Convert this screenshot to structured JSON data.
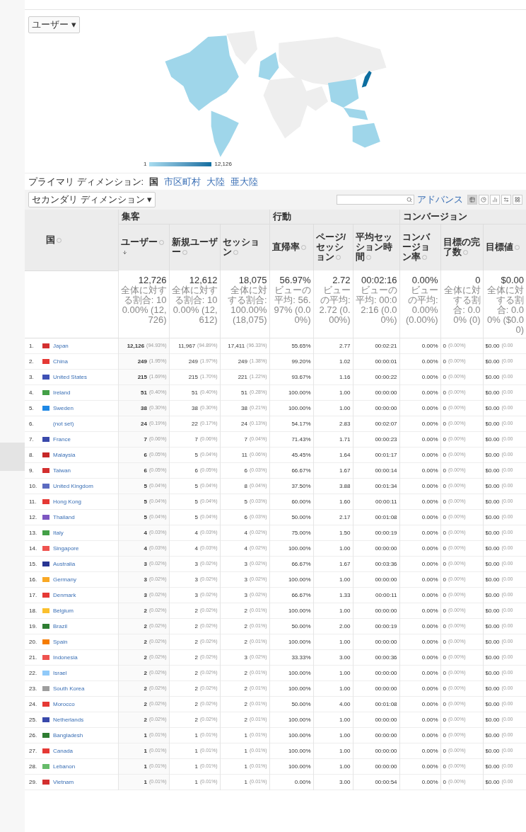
{
  "map": {
    "metric_menu": "ユーザー ▾",
    "legend": {
      "min": "1",
      "max": "12,126"
    }
  },
  "primary_dimension": {
    "label": "プライマリ ディメンション:",
    "options": [
      {
        "label": "国",
        "selected": true
      },
      {
        "label": "市区町村",
        "selected": false
      },
      {
        "label": "大陸",
        "selected": false
      },
      {
        "label": "亜大陸",
        "selected": false
      }
    ]
  },
  "toolbar": {
    "secondary_dimension": "セカンダリ ディメンション ▾",
    "advanced_link": "アドバンス",
    "view_buttons": [
      {
        "kind": "table",
        "selected": true
      },
      {
        "kind": "pie",
        "selected": false
      },
      {
        "kind": "bar",
        "selected": false
      },
      {
        "kind": "compare",
        "selected": false
      },
      {
        "kind": "pivot",
        "selected": false
      }
    ]
  },
  "table": {
    "dimension_header": "国",
    "groups": [
      {
        "label": "集客"
      },
      {
        "label": "行動"
      },
      {
        "label": "コンバージョン"
      }
    ],
    "columns": [
      {
        "label": "ユーザー",
        "sorted": true
      },
      {
        "label": "新規ユーザー",
        "sorted": false
      },
      {
        "label": "セッション",
        "sorted": false
      },
      {
        "label": "直帰率",
        "sorted": false
      },
      {
        "label": "ページ/セッション",
        "sorted": false
      },
      {
        "label": "平均セッション時間",
        "sorted": false
      },
      {
        "label": "コンバージョン率",
        "sorted": false
      },
      {
        "label": "目標の完了数",
        "sorted": false
      },
      {
        "label": "目標値",
        "sorted": false
      }
    ],
    "totals": [
      {
        "value": "12,726",
        "note": "全体に対する割合: 100.00% (12,726)"
      },
      {
        "value": "12,612",
        "note": "全体に対する割合: 100.00% (12,612)"
      },
      {
        "value": "18,075",
        "note": "全体に対する割合: 100.00% (18,075)"
      },
      {
        "value": "56.97%",
        "note": "ビューの平均: 56.97% (0.00%)"
      },
      {
        "value": "2.72",
        "note": "ビューの平均: 2.72 (0.00%)"
      },
      {
        "value": "00:02:16",
        "note": "ビューの平均: 00:02:16 (0.00%)"
      },
      {
        "value": "0.00%",
        "note": "ビューの平均: 0.00% (0.00%)"
      },
      {
        "value": "0",
        "note": "全体に対する割合: 0.00% (0)"
      },
      {
        "value": "$0.00",
        "note": "全体に対する割合: 0.00% ($0.00)"
      }
    ],
    "rows": [
      {
        "rank": "1.",
        "country": "Japan",
        "color": "#d32f2f",
        "cells": [
          [
            "12,126",
            "(94.93%)"
          ],
          [
            "11,967",
            "(94.89%)"
          ],
          [
            "17,411",
            "(96.33%)"
          ],
          [
            "55.65%"
          ],
          [
            "2.77"
          ],
          [
            "00:02:21"
          ],
          [
            "0.00%"
          ],
          [
            "0",
            "(0.00%)"
          ],
          [
            "$0.00",
            "(0.00"
          ]
        ]
      },
      {
        "rank": "2.",
        "country": "China",
        "color": "#e53935",
        "cells": [
          [
            "249",
            "(1.95%)"
          ],
          [
            "249",
            "(1.97%)"
          ],
          [
            "249",
            "(1.38%)"
          ],
          [
            "99.20%"
          ],
          [
            "1.02"
          ],
          [
            "00:00:01"
          ],
          [
            "0.00%"
          ],
          [
            "0",
            "(0.00%)"
          ],
          [
            "$0.00",
            "(0.00"
          ]
        ]
      },
      {
        "rank": "3.",
        "country": "United States",
        "color": "#3f51b5",
        "cells": [
          [
            "215",
            "(1.69%)"
          ],
          [
            "215",
            "(1.70%)"
          ],
          [
            "221",
            "(1.22%)"
          ],
          [
            "93.67%"
          ],
          [
            "1.16"
          ],
          [
            "00:00:22"
          ],
          [
            "0.00%"
          ],
          [
            "0",
            "(0.00%)"
          ],
          [
            "$0.00",
            "(0.00"
          ]
        ]
      },
      {
        "rank": "4.",
        "country": "Ireland",
        "color": "#43a047",
        "cells": [
          [
            "51",
            "(0.40%)"
          ],
          [
            "51",
            "(0.40%)"
          ],
          [
            "51",
            "(0.28%)"
          ],
          [
            "100.00%"
          ],
          [
            "1.00"
          ],
          [
            "00:00:00"
          ],
          [
            "0.00%"
          ],
          [
            "0",
            "(0.00%)"
          ],
          [
            "$0.00",
            "(0.00"
          ]
        ]
      },
      {
        "rank": "5.",
        "country": "Sweden",
        "color": "#1e88e5",
        "cells": [
          [
            "38",
            "(0.30%)"
          ],
          [
            "38",
            "(0.30%)"
          ],
          [
            "38",
            "(0.21%)"
          ],
          [
            "100.00%"
          ],
          [
            "1.00"
          ],
          [
            "00:00:00"
          ],
          [
            "0.00%"
          ],
          [
            "0",
            "(0.00%)"
          ],
          [
            "$0.00",
            "(0.00"
          ]
        ]
      },
      {
        "rank": "6.",
        "country": "(not set)",
        "cells": [
          [
            "24",
            "(0.19%)"
          ],
          [
            "22",
            "(0.17%)"
          ],
          [
            "24",
            "(0.13%)"
          ],
          [
            "54.17%"
          ],
          [
            "2.83"
          ],
          [
            "00:02:07"
          ],
          [
            "0.00%"
          ],
          [
            "0",
            "(0.00%)"
          ],
          [
            "$0.00",
            "(0.00"
          ]
        ]
      },
      {
        "rank": "7.",
        "country": "France",
        "color": "#3949ab",
        "cells": [
          [
            "7",
            "(0.06%)"
          ],
          [
            "7",
            "(0.06%)"
          ],
          [
            "7",
            "(0.04%)"
          ],
          [
            "71.43%"
          ],
          [
            "1.71"
          ],
          [
            "00:00:23"
          ],
          [
            "0.00%"
          ],
          [
            "0",
            "(0.00%)"
          ],
          [
            "$0.00",
            "(0.00"
          ]
        ]
      },
      {
        "rank": "8.",
        "country": "Malaysia",
        "color": "#c62828",
        "cells": [
          [
            "6",
            "(0.05%)"
          ],
          [
            "5",
            "(0.04%)"
          ],
          [
            "11",
            "(0.06%)"
          ],
          [
            "45.45%"
          ],
          [
            "1.64"
          ],
          [
            "00:01:17"
          ],
          [
            "0.00%"
          ],
          [
            "0",
            "(0.00%)"
          ],
          [
            "$0.00",
            "(0.00"
          ]
        ]
      },
      {
        "rank": "9.",
        "country": "Taiwan",
        "color": "#d32f2f",
        "cells": [
          [
            "6",
            "(0.05%)"
          ],
          [
            "6",
            "(0.05%)"
          ],
          [
            "6",
            "(0.03%)"
          ],
          [
            "66.67%"
          ],
          [
            "1.67"
          ],
          [
            "00:00:14"
          ],
          [
            "0.00%"
          ],
          [
            "0",
            "(0.00%)"
          ],
          [
            "$0.00",
            "(0.00"
          ]
        ]
      },
      {
        "rank": "10.",
        "country": "United Kingdom",
        "color": "#5c6bc0",
        "cells": [
          [
            "5",
            "(0.04%)"
          ],
          [
            "5",
            "(0.04%)"
          ],
          [
            "8",
            "(0.04%)"
          ],
          [
            "37.50%"
          ],
          [
            "3.88"
          ],
          [
            "00:01:34"
          ],
          [
            "0.00%"
          ],
          [
            "0",
            "(0.00%)"
          ],
          [
            "$0.00",
            "(0.00"
          ]
        ]
      },
      {
        "rank": "11.",
        "country": "Hong Kong",
        "color": "#e53935",
        "cells": [
          [
            "5",
            "(0.04%)"
          ],
          [
            "5",
            "(0.04%)"
          ],
          [
            "5",
            "(0.03%)"
          ],
          [
            "60.00%"
          ],
          [
            "1.60"
          ],
          [
            "00:00:11"
          ],
          [
            "0.00%"
          ],
          [
            "0",
            "(0.00%)"
          ],
          [
            "$0.00",
            "(0.00"
          ]
        ]
      },
      {
        "rank": "12.",
        "country": "Thailand",
        "color": "#7e57c2",
        "cells": [
          [
            "5",
            "(0.04%)"
          ],
          [
            "5",
            "(0.04%)"
          ],
          [
            "6",
            "(0.03%)"
          ],
          [
            "50.00%"
          ],
          [
            "2.17"
          ],
          [
            "00:01:08"
          ],
          [
            "0.00%"
          ],
          [
            "0",
            "(0.00%)"
          ],
          [
            "$0.00",
            "(0.00"
          ]
        ]
      },
      {
        "rank": "13.",
        "country": "Italy",
        "color": "#43a047",
        "cells": [
          [
            "4",
            "(0.03%)"
          ],
          [
            "4",
            "(0.03%)"
          ],
          [
            "4",
            "(0.02%)"
          ],
          [
            "75.00%"
          ],
          [
            "1.50"
          ],
          [
            "00:00:19"
          ],
          [
            "0.00%"
          ],
          [
            "0",
            "(0.00%)"
          ],
          [
            "$0.00",
            "(0.00"
          ]
        ]
      },
      {
        "rank": "14.",
        "country": "Singapore",
        "color": "#ef5350",
        "cells": [
          [
            "4",
            "(0.03%)"
          ],
          [
            "4",
            "(0.03%)"
          ],
          [
            "4",
            "(0.02%)"
          ],
          [
            "100.00%"
          ],
          [
            "1.00"
          ],
          [
            "00:00:00"
          ],
          [
            "0.00%"
          ],
          [
            "0",
            "(0.00%)"
          ],
          [
            "$0.00",
            "(0.00"
          ]
        ]
      },
      {
        "rank": "15.",
        "country": "Australia",
        "color": "#283593",
        "cells": [
          [
            "3",
            "(0.02%)"
          ],
          [
            "3",
            "(0.02%)"
          ],
          [
            "3",
            "(0.02%)"
          ],
          [
            "66.67%"
          ],
          [
            "1.67"
          ],
          [
            "00:03:36"
          ],
          [
            "0.00%"
          ],
          [
            "0",
            "(0.00%)"
          ],
          [
            "$0.00",
            "(0.00"
          ]
        ]
      },
      {
        "rank": "16.",
        "country": "Germany",
        "color": "#f9a825",
        "cells": [
          [
            "3",
            "(0.02%)"
          ],
          [
            "3",
            "(0.02%)"
          ],
          [
            "3",
            "(0.02%)"
          ],
          [
            "100.00%"
          ],
          [
            "1.00"
          ],
          [
            "00:00:00"
          ],
          [
            "0.00%"
          ],
          [
            "0",
            "(0.00%)"
          ],
          [
            "$0.00",
            "(0.00"
          ]
        ]
      },
      {
        "rank": "17.",
        "country": "Denmark",
        "color": "#e53935",
        "cells": [
          [
            "3",
            "(0.02%)"
          ],
          [
            "3",
            "(0.02%)"
          ],
          [
            "3",
            "(0.02%)"
          ],
          [
            "66.67%"
          ],
          [
            "1.33"
          ],
          [
            "00:00:11"
          ],
          [
            "0.00%"
          ],
          [
            "0",
            "(0.00%)"
          ],
          [
            "$0.00",
            "(0.00"
          ]
        ]
      },
      {
        "rank": "18.",
        "country": "Belgium",
        "color": "#fbc02d",
        "cells": [
          [
            "2",
            "(0.02%)"
          ],
          [
            "2",
            "(0.02%)"
          ],
          [
            "2",
            "(0.01%)"
          ],
          [
            "100.00%"
          ],
          [
            "1.00"
          ],
          [
            "00:00:00"
          ],
          [
            "0.00%"
          ],
          [
            "0",
            "(0.00%)"
          ],
          [
            "$0.00",
            "(0.00"
          ]
        ]
      },
      {
        "rank": "19.",
        "country": "Brazil",
        "color": "#2e7d32",
        "cells": [
          [
            "2",
            "(0.02%)"
          ],
          [
            "2",
            "(0.02%)"
          ],
          [
            "2",
            "(0.01%)"
          ],
          [
            "50.00%"
          ],
          [
            "2.00"
          ],
          [
            "00:00:19"
          ],
          [
            "0.00%"
          ],
          [
            "0",
            "(0.00%)"
          ],
          [
            "$0.00",
            "(0.00"
          ]
        ]
      },
      {
        "rank": "20.",
        "country": "Spain",
        "color": "#f57c00",
        "cells": [
          [
            "2",
            "(0.02%)"
          ],
          [
            "2",
            "(0.02%)"
          ],
          [
            "2",
            "(0.01%)"
          ],
          [
            "100.00%"
          ],
          [
            "1.00"
          ],
          [
            "00:00:00"
          ],
          [
            "0.00%"
          ],
          [
            "0",
            "(0.00%)"
          ],
          [
            "$0.00",
            "(0.00"
          ]
        ]
      },
      {
        "rank": "21.",
        "country": "Indonesia",
        "color": "#ef5350",
        "cells": [
          [
            "2",
            "(0.02%)"
          ],
          [
            "2",
            "(0.02%)"
          ],
          [
            "3",
            "(0.02%)"
          ],
          [
            "33.33%"
          ],
          [
            "3.00"
          ],
          [
            "00:00:36"
          ],
          [
            "0.00%"
          ],
          [
            "0",
            "(0.00%)"
          ],
          [
            "$0.00",
            "(0.00"
          ]
        ]
      },
      {
        "rank": "22.",
        "country": "Israel",
        "color": "#90caf9",
        "cells": [
          [
            "2",
            "(0.02%)"
          ],
          [
            "2",
            "(0.02%)"
          ],
          [
            "2",
            "(0.01%)"
          ],
          [
            "100.00%"
          ],
          [
            "1.00"
          ],
          [
            "00:00:00"
          ],
          [
            "0.00%"
          ],
          [
            "0",
            "(0.00%)"
          ],
          [
            "$0.00",
            "(0.00"
          ]
        ]
      },
      {
        "rank": "23.",
        "country": "South Korea",
        "color": "#9e9e9e",
        "cells": [
          [
            "2",
            "(0.02%)"
          ],
          [
            "2",
            "(0.02%)"
          ],
          [
            "2",
            "(0.01%)"
          ],
          [
            "100.00%"
          ],
          [
            "1.00"
          ],
          [
            "00:00:00"
          ],
          [
            "0.00%"
          ],
          [
            "0",
            "(0.00%)"
          ],
          [
            "$0.00",
            "(0.00"
          ]
        ]
      },
      {
        "rank": "24.",
        "country": "Morocco",
        "color": "#e53935",
        "cells": [
          [
            "2",
            "(0.02%)"
          ],
          [
            "2",
            "(0.02%)"
          ],
          [
            "2",
            "(0.01%)"
          ],
          [
            "50.00%"
          ],
          [
            "4.00"
          ],
          [
            "00:01:08"
          ],
          [
            "0.00%"
          ],
          [
            "0",
            "(0.00%)"
          ],
          [
            "$0.00",
            "(0.00"
          ]
        ]
      },
      {
        "rank": "25.",
        "country": "Netherlands",
        "color": "#3949ab",
        "cells": [
          [
            "2",
            "(0.02%)"
          ],
          [
            "2",
            "(0.02%)"
          ],
          [
            "2",
            "(0.01%)"
          ],
          [
            "100.00%"
          ],
          [
            "1.00"
          ],
          [
            "00:00:00"
          ],
          [
            "0.00%"
          ],
          [
            "0",
            "(0.00%)"
          ],
          [
            "$0.00",
            "(0.00"
          ]
        ]
      },
      {
        "rank": "26.",
        "country": "Bangladesh",
        "color": "#2e7d32",
        "cells": [
          [
            "1",
            "(0.01%)"
          ],
          [
            "1",
            "(0.01%)"
          ],
          [
            "1",
            "(0.01%)"
          ],
          [
            "100.00%"
          ],
          [
            "1.00"
          ],
          [
            "00:00:00"
          ],
          [
            "0.00%"
          ],
          [
            "0",
            "(0.00%)"
          ],
          [
            "$0.00",
            "(0.00"
          ]
        ]
      },
      {
        "rank": "27.",
        "country": "Canada",
        "color": "#e53935",
        "cells": [
          [
            "1",
            "(0.01%)"
          ],
          [
            "1",
            "(0.01%)"
          ],
          [
            "1",
            "(0.01%)"
          ],
          [
            "100.00%"
          ],
          [
            "1.00"
          ],
          [
            "00:00:00"
          ],
          [
            "0.00%"
          ],
          [
            "0",
            "(0.00%)"
          ],
          [
            "$0.00",
            "(0.00"
          ]
        ]
      },
      {
        "rank": "28.",
        "country": "Lebanon",
        "color": "#66bb6a",
        "cells": [
          [
            "1",
            "(0.01%)"
          ],
          [
            "1",
            "(0.01%)"
          ],
          [
            "1",
            "(0.01%)"
          ],
          [
            "100.00%"
          ],
          [
            "1.00"
          ],
          [
            "00:00:00"
          ],
          [
            "0.00%"
          ],
          [
            "0",
            "(0.00%)"
          ],
          [
            "$0.00",
            "(0.00"
          ]
        ]
      },
      {
        "rank": "29.",
        "country": "Vietnam",
        "color": "#d32f2f",
        "cells": [
          [
            "1",
            "(0.01%)"
          ],
          [
            "1",
            "(0.01%)"
          ],
          [
            "1",
            "(0.01%)"
          ],
          [
            "0.00%"
          ],
          [
            "3.00"
          ],
          [
            "00:00:54"
          ],
          [
            "0.00%"
          ],
          [
            "0",
            "(0.00%)"
          ],
          [
            "$0.00",
            "(0.00"
          ]
        ]
      }
    ]
  }
}
